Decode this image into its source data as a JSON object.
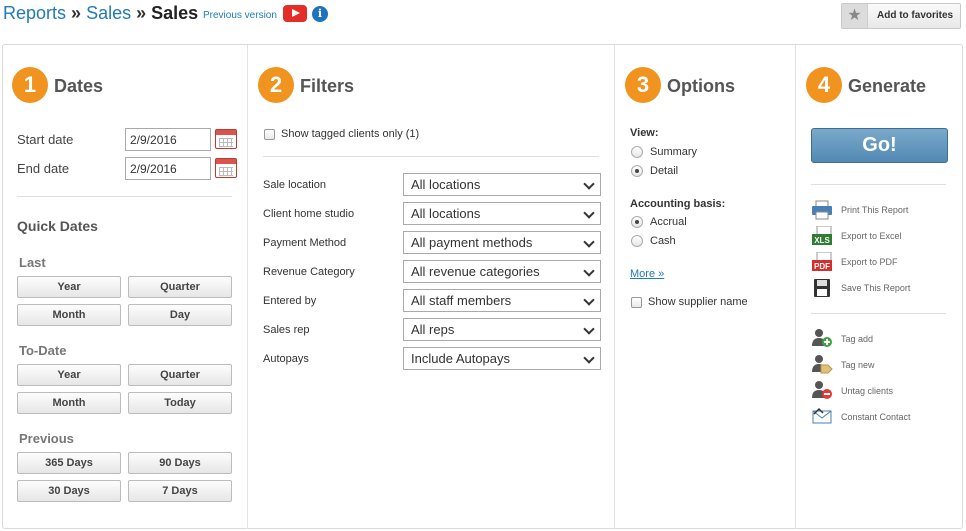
{
  "header": {
    "breadcrumb": [
      {
        "label": "Reports",
        "link": true
      },
      {
        "label": "Sales",
        "link": true
      },
      {
        "label": "Sales",
        "link": false
      }
    ],
    "separator": "»",
    "previous_version": "Previous version",
    "add_favorites": "Add to favorites"
  },
  "dates": {
    "step": "1",
    "title": "Dates",
    "start_label": "Start date",
    "start_value": "2/9/2016",
    "end_label": "End date",
    "end_value": "2/9/2016",
    "quick_title": "Quick Dates",
    "last_title": "Last",
    "last_buttons": [
      "Year",
      "Quarter",
      "Month",
      "Day"
    ],
    "todate_title": "To-Date",
    "todate_buttons": [
      "Year",
      "Quarter",
      "Month",
      "Today"
    ],
    "previous_title": "Previous",
    "previous_buttons": [
      "365 Days",
      "90 Days",
      "30 Days",
      "7 Days"
    ]
  },
  "filters": {
    "step": "2",
    "title": "Filters",
    "tagged_only": "Show tagged clients only (1)",
    "rows": [
      {
        "label": "Sale location",
        "value": "All locations"
      },
      {
        "label": "Client home studio",
        "value": "All locations"
      },
      {
        "label": "Payment Method",
        "value": "All payment methods"
      },
      {
        "label": "Revenue Category",
        "value": "All revenue categories"
      },
      {
        "label": "Entered by",
        "value": "All staff members"
      },
      {
        "label": "Sales rep",
        "value": "All reps"
      },
      {
        "label": "Autopays",
        "value": "Include Autopays"
      }
    ]
  },
  "options": {
    "step": "3",
    "title": "Options",
    "view_label": "View:",
    "view_options": [
      {
        "label": "Summary",
        "selected": false
      },
      {
        "label": "Detail",
        "selected": true
      }
    ],
    "basis_label": "Accounting basis:",
    "basis_options": [
      {
        "label": "Accrual",
        "selected": true
      },
      {
        "label": "Cash",
        "selected": false
      }
    ],
    "more": "More »",
    "supplier": "Show supplier name"
  },
  "generate": {
    "step": "4",
    "title": "Generate",
    "go": "Go!",
    "actions": [
      {
        "label": "Print This Report",
        "icon": "printer-icon"
      },
      {
        "label": "Export to Excel",
        "icon": "xls-icon"
      },
      {
        "label": "Export to PDF",
        "icon": "pdf-icon"
      },
      {
        "label": "Save This Report",
        "icon": "save-icon"
      }
    ],
    "tag_actions": [
      {
        "label": "Tag add",
        "icon": "tag-add-icon"
      },
      {
        "label": "Tag new",
        "icon": "tag-new-icon"
      },
      {
        "label": "Untag clients",
        "icon": "untag-icon"
      },
      {
        "label": "Constant Contact",
        "icon": "constant-contact-icon"
      }
    ]
  },
  "colors": {
    "accent": "#f0931f",
    "link": "#1f7ab8",
    "go_button": "#6397bf"
  }
}
